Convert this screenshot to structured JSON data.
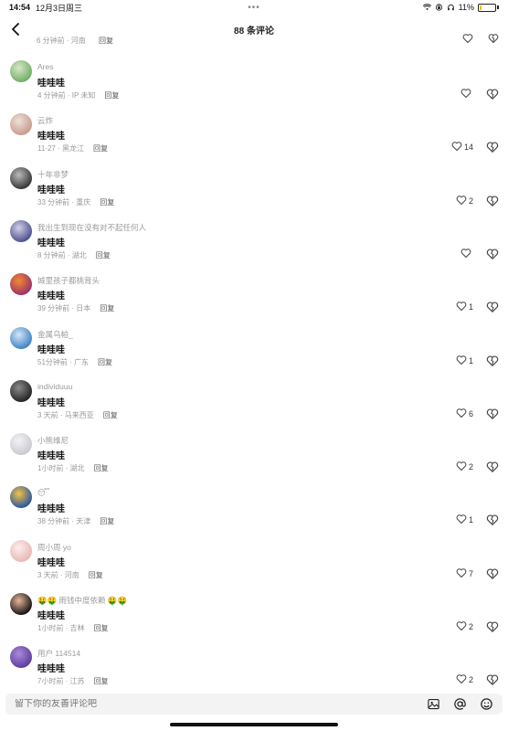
{
  "status_bar": {
    "time": "14:54",
    "date": "12月3日周三",
    "center_dots": "•••",
    "battery": "11%",
    "battery_level": 0.11
  },
  "header": {
    "title": "88 条评论"
  },
  "partial_top": {
    "time": "6 分钟前 · 河南",
    "reply": "回复"
  },
  "comments": [
    {
      "username": "Ares",
      "content": "哇哇哇",
      "time": "4 分钟前 · IP 未知",
      "reply": "回复",
      "likes": ""
    },
    {
      "username": "云炸",
      "content": "哇哇哇",
      "time": "11-27 · 黑龙江",
      "reply": "回复",
      "likes": "14"
    },
    {
      "username": "十年非梦",
      "content": "哇哇哇",
      "time": "33 分钟前 · 重庆",
      "reply": "回复",
      "likes": "2"
    },
    {
      "username": "我出生到现在没有对不起任何人",
      "content": "哇哇哇",
      "time": "8 分钟前 · 湖北",
      "reply": "回复",
      "likes": ""
    },
    {
      "username": "城里孩子都桃背头",
      "content": "哇哇哇",
      "time": "39 分钟前 · 日本",
      "reply": "回复",
      "likes": "1"
    },
    {
      "username": "金属乌帕_",
      "content": "哇哇哇",
      "time": "51分钟前 · 广东",
      "reply": "回复",
      "likes": "1"
    },
    {
      "username": "individuuu",
      "content": "哇哇哇",
      "time": "3 天前 · 马来西亚",
      "reply": "回复",
      "likes": "6"
    },
    {
      "username": "小熊维尼",
      "content": "哇哇哇",
      "time": "1小时前 · 湖北",
      "reply": "回复",
      "likes": "2"
    },
    {
      "username": "😴",
      "content": "哇哇哇",
      "time": "38 分钟前 · 天津",
      "reply": "回复",
      "likes": "1"
    },
    {
      "username": "周小周 yo",
      "content": "哇哇哇",
      "time": "3 天前 · 河南",
      "reply": "回复",
      "likes": "7"
    },
    {
      "username": "🤑🤑 雨钱中度依赖 🤑🤑",
      "content": "哇哇哇",
      "time": "1小时前 · 吉林",
      "reply": "回复",
      "likes": "2"
    },
    {
      "username": "用户 114514",
      "content": "哇哇哇",
      "time": "7小时前 · 江苏",
      "reply": "回复",
      "likes": "2"
    }
  ],
  "input": {
    "placeholder": "留下你的友善评论吧"
  },
  "icons": {
    "back": "chevron-left-icon",
    "like": "heart-icon",
    "dislike": "broken-heart-icon",
    "image": "image-icon",
    "mention": "at-icon",
    "emoji": "emoji-icon"
  }
}
